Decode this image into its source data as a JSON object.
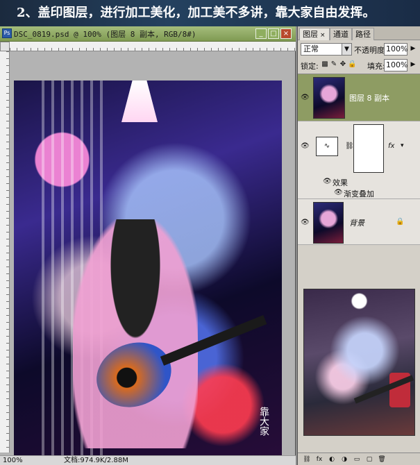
{
  "banner": {
    "text": "2、盖印图层，进行加工美化，加工美不多讲，靠大家自由发挥。"
  },
  "document": {
    "title": "DSC_0819.psd @ 100% (图层 8 副本, RGB/8#)",
    "status_zoom": "100%",
    "status_doc": "文档:974.9K/2.88M",
    "signature": "靠大家"
  },
  "panel": {
    "tabs": [
      {
        "label": "图层",
        "close": "×",
        "active": true
      },
      {
        "label": "通道",
        "active": false
      },
      {
        "label": "路径",
        "active": false
      }
    ],
    "blend_mode": "正常",
    "opacity_label": "不透明度:",
    "opacity_value": "100%",
    "lock_label": "锁定:",
    "fill_label": "填充:",
    "fill_value": "100%",
    "layers": [
      {
        "name": "图层 8 副本",
        "selected": true
      },
      {
        "name": "",
        "type": "adjustment",
        "fx": "fx"
      },
      {
        "name": "背景",
        "locked": true
      }
    ],
    "effects_label": "效果",
    "gradient_overlay_label": "渐变叠加"
  },
  "icons": {
    "psd": "psd-icon",
    "eye": "eye-icon",
    "lock": "lock-icon"
  },
  "colors": {
    "titlebar": "#8fae5f",
    "selected_layer": "#8e9c63",
    "banner": "#1b2a3e"
  }
}
